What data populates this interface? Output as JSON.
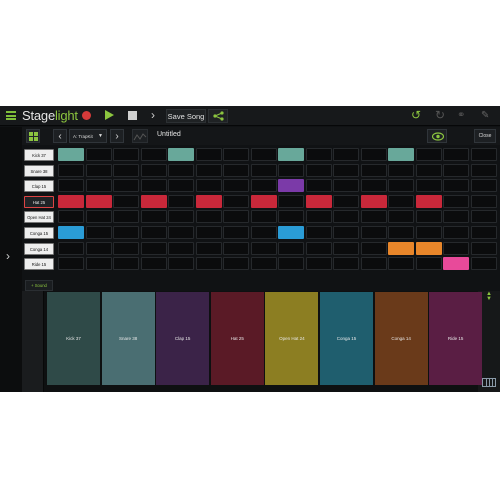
{
  "app": {
    "name_prefix": "Stage",
    "name_suffix": "light"
  },
  "toolbar": {
    "save_label": "Save Song"
  },
  "subbar": {
    "kit_label": "A: TrapKit",
    "song_title": "Untitled",
    "close_label": "Close"
  },
  "colors": {
    "accent": "#8cc63f",
    "record": "#d43a3a",
    "step_kick": "#68a89a",
    "step_clap": "#7b3aa8",
    "step_hat": "#c9283a",
    "step_conga": "#2a9cd6",
    "step_congalow": "#e8862a",
    "step_ride": "#e84a9a"
  },
  "tracks": [
    {
      "label": "Kick 37",
      "color": "#68a89a",
      "steps": [
        1,
        0,
        0,
        0,
        1,
        0,
        0,
        0,
        1,
        0,
        0,
        0,
        1,
        0,
        0,
        0
      ]
    },
    {
      "label": "Snare 38",
      "color": "#5a8a8c",
      "steps": [
        0,
        0,
        0,
        0,
        0,
        0,
        0,
        0,
        0,
        0,
        0,
        0,
        0,
        0,
        0,
        0
      ]
    },
    {
      "label": "Clap 15",
      "color": "#7b3aa8",
      "steps": [
        0,
        0,
        0,
        0,
        0,
        0,
        0,
        0,
        1,
        0,
        0,
        0,
        0,
        0,
        0,
        0
      ]
    },
    {
      "label": "Hat 25",
      "color": "#c9283a",
      "steps": [
        1,
        1,
        0,
        1,
        0,
        1,
        0,
        1,
        0,
        1,
        0,
        1,
        0,
        1,
        0,
        0
      ]
    },
    {
      "label": "Open Hat 24",
      "color": "#b0a020",
      "steps": [
        0,
        0,
        0,
        0,
        0,
        0,
        0,
        0,
        0,
        0,
        0,
        0,
        0,
        0,
        0,
        0
      ]
    },
    {
      "label": "Conga 15",
      "color": "#2a9cd6",
      "steps": [
        1,
        0,
        0,
        0,
        0,
        0,
        0,
        0,
        1,
        0,
        0,
        0,
        0,
        0,
        0,
        0
      ]
    },
    {
      "label": "Conga 14",
      "color": "#e8862a",
      "steps": [
        0,
        0,
        0,
        0,
        0,
        0,
        0,
        0,
        0,
        0,
        0,
        0,
        1,
        1,
        0,
        0
      ]
    },
    {
      "label": "Ride 15",
      "color": "#e84a9a",
      "steps": [
        0,
        0,
        0,
        0,
        0,
        0,
        0,
        0,
        0,
        0,
        0,
        0,
        0,
        0,
        1,
        0
      ]
    }
  ],
  "selected_track": 3,
  "add_sound_label": "+ Sound",
  "pads": [
    {
      "label": "Kick 37",
      "color": "#2f4a48"
    },
    {
      "label": "Snare 38",
      "color": "#4a6e72"
    },
    {
      "label": "Clap 15",
      "color": "#3b2348"
    },
    {
      "label": "Hat 25",
      "color": "#5a1a26"
    },
    {
      "label": "Open Hat 24",
      "color": "#8c7e22"
    },
    {
      "label": "Conga 15",
      "color": "#1f5e6e"
    },
    {
      "label": "Conga 14",
      "color": "#6a3a1a"
    },
    {
      "label": "Ride 15",
      "color": "#5a1e44"
    }
  ]
}
